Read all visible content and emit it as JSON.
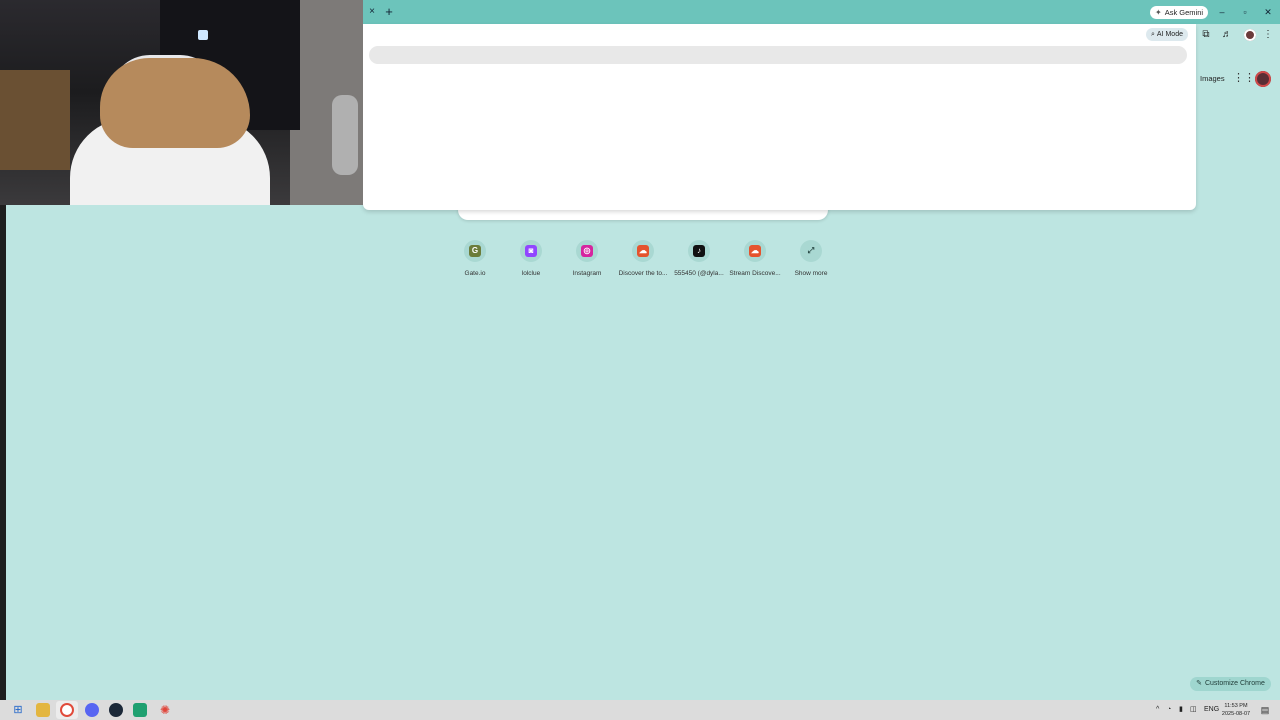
{
  "browser": {
    "tab_close_glyph": "×",
    "new_tab_glyph": "+",
    "ask_gemini_label": "Ask Gemini",
    "window_controls": {
      "minimize": "–",
      "maximize": "▫",
      "close": "✕"
    }
  },
  "omnibox_dropdown": {
    "ai_mode_label": "AI Mode"
  },
  "google_header": {
    "images_label": "Images"
  },
  "shortcuts": [
    {
      "label": "Gate.io",
      "icon": "gate-io-icon",
      "glyph": "G",
      "color": "#6b7c3a"
    },
    {
      "label": "lolclue",
      "icon": "twitch-icon",
      "glyph": "◙",
      "color": "#9146ff"
    },
    {
      "label": "Instagram",
      "icon": "instagram-icon",
      "glyph": "◎",
      "color": "#d6249f"
    },
    {
      "label": "Discover the to...",
      "icon": "soundcloud-icon",
      "glyph": "☁",
      "color": "#e5532d"
    },
    {
      "label": "555450 (@dyla...",
      "icon": "tiktok-icon",
      "glyph": "♪",
      "color": "#111111"
    },
    {
      "label": "Stream Discove...",
      "icon": "soundcloud-icon",
      "glyph": "☁",
      "color": "#e5532d"
    },
    {
      "label": "Show more",
      "icon": "expand-icon",
      "glyph": "⤢",
      "color": "#a9d8d2"
    }
  ],
  "customize_chrome_label": "Customize Chrome",
  "taskbar": {
    "lang": "ENG",
    "time": "11:53 PM",
    "date": "2025-08-07"
  },
  "colors": {
    "page_bg": "#bde5e1",
    "tabstrip": "#6cc4bb",
    "dropdown_bg": "#ffffff"
  }
}
